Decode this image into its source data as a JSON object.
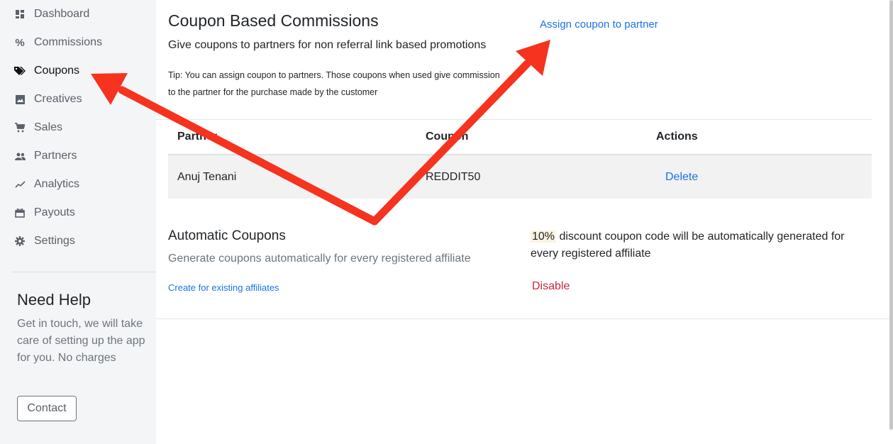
{
  "sidebar": {
    "items": [
      {
        "label": "Dashboard",
        "icon": "dashboard-icon",
        "active": false
      },
      {
        "label": "Commissions",
        "icon": "percent-icon",
        "active": false
      },
      {
        "label": "Coupons",
        "icon": "tag-icon",
        "active": true
      },
      {
        "label": "Creatives",
        "icon": "image-icon",
        "active": false
      },
      {
        "label": "Sales",
        "icon": "cart-icon",
        "active": false
      },
      {
        "label": "Partners",
        "icon": "people-icon",
        "active": false
      },
      {
        "label": "Analytics",
        "icon": "trending-icon",
        "active": false
      },
      {
        "label": "Payouts",
        "icon": "gift-icon",
        "active": false
      },
      {
        "label": "Settings",
        "icon": "gear-icon",
        "active": false
      }
    ],
    "help": {
      "title": "Need Help",
      "text": "Get in touch, we will take care of setting up the app for you. No charges",
      "contact_label": "Contact"
    }
  },
  "main": {
    "title": "Coupon Based Commissions",
    "subtitle": "Give coupons to partners for non referral link based promotions",
    "tip": "Tip: You can assign coupon to partners. Those coupons when used give commission to the partner for the purchase made by the customer",
    "assign_link": "Assign coupon to partner",
    "table": {
      "headers": [
        "Partner",
        "Coupon",
        "Actions"
      ],
      "rows": [
        {
          "partner": "Anuj Tenani",
          "coupon": "REDDIT50",
          "action": "Delete"
        }
      ]
    },
    "automatic": {
      "title": "Automatic Coupons",
      "description": "Generate coupons automatically for every registered affiliate",
      "create_link": "Create for existing affiliates",
      "discount_value": "10%",
      "discount_text": " discount coupon code will be automatically generated for every registered affiliate",
      "disable_label": "Disable"
    }
  },
  "colors": {
    "link": "#1a73e8",
    "danger": "#c8283c",
    "annotation_arrow": "#f5331e",
    "sidebar_bg": "#f4f5f7"
  }
}
